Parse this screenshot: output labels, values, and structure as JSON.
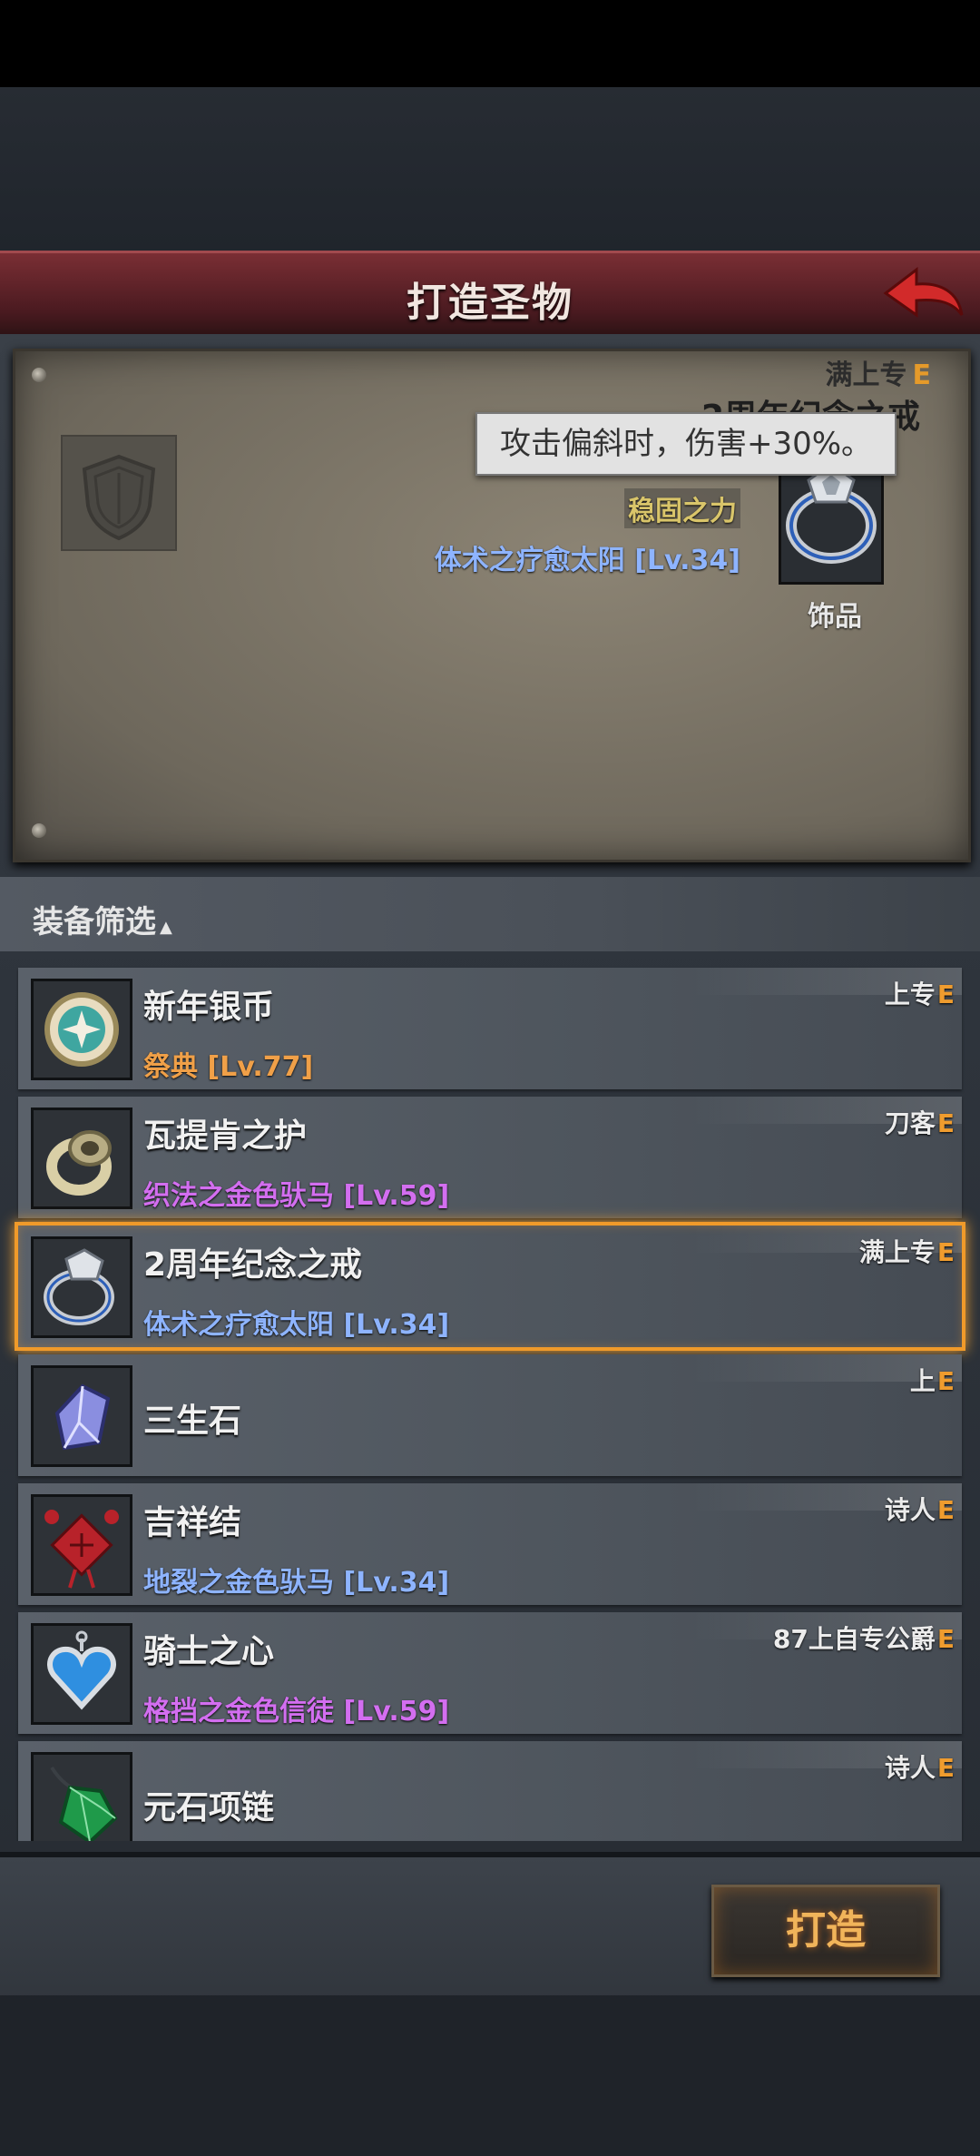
{
  "header": {
    "title": "打造圣物"
  },
  "preview": {
    "attr": "满上专",
    "grade": "E",
    "name": "2周年纪念之戒",
    "tooltip": "攻击偏斜时，伤害+30%。",
    "skill": "稳固之力",
    "set": "体术之疗愈太阳 [Lv.34]",
    "category": "饰品"
  },
  "filter": {
    "label": "装备筛选"
  },
  "items": [
    {
      "name": "新年银币",
      "set": "祭典 [Lv.77]",
      "attr": "上专",
      "grade": "E",
      "color": "#f0a048",
      "icon": "coin-icon"
    },
    {
      "name": "瓦提肯之护",
      "set": "织法之金色驮马 [Lv.59]",
      "attr": "刀客",
      "grade": "E",
      "color": "#d36ef0",
      "icon": "ring-icon"
    },
    {
      "name": "2周年纪念之戒",
      "set": "体术之疗愈太阳 [Lv.34]",
      "attr": "满上专",
      "grade": "E",
      "color": "#8eb4ff",
      "icon": "anniversary-ring-icon"
    },
    {
      "name": "三生石",
      "set": "",
      "attr": "上",
      "grade": "E",
      "color": "#8eb4ff",
      "icon": "crystal-stone-icon"
    },
    {
      "name": "吉祥结",
      "set": "地裂之金色驮马 [Lv.34]",
      "attr": "诗人",
      "grade": "E",
      "color": "#8eb4ff",
      "icon": "knot-icon"
    },
    {
      "name": "骑士之心",
      "set": "格挡之金色信徒 [Lv.59]",
      "attr": "87上自专公爵",
      "grade": "E",
      "color": "#d36ef0",
      "icon": "heart-pendant-icon"
    },
    {
      "name": "元石项链",
      "set": "",
      "attr": "诗人",
      "grade": "E",
      "color": "#8eb4ff",
      "icon": "green-crystal-icon"
    }
  ],
  "actions": {
    "forge": "打造"
  }
}
